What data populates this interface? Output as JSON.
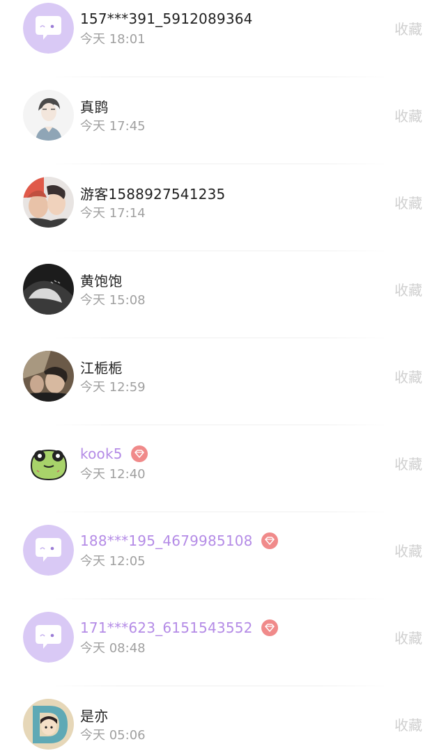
{
  "favorite_label": "收藏",
  "colors": {
    "vip_name": "#b48be6",
    "vip_badge": "#f08a8a",
    "default_avatar_bg": "#d9c9f5",
    "time_text": "#a0a0a0",
    "favorite_text": "#cfcfcf"
  },
  "visitors": [
    {
      "name": "157***391_5912089364",
      "time": "今天 18:01",
      "vip": false,
      "avatar": "default-chat-avatar"
    },
    {
      "name": "真鹍",
      "time": "今天 17:45",
      "vip": false,
      "avatar": "anime-boy-avatar"
    },
    {
      "name": "游客1588927541235",
      "time": "今天 17:14",
      "vip": false,
      "avatar": "couple-photo-avatar"
    },
    {
      "name": "黄饱饱",
      "time": "今天 15:08",
      "vip": false,
      "avatar": "dark-photo-avatar"
    },
    {
      "name": "江栀栀",
      "time": "今天 12:59",
      "vip": false,
      "avatar": "selfie-photo-avatar"
    },
    {
      "name": "kook5",
      "time": "今天 12:40",
      "vip": true,
      "avatar": "green-frog-avatar"
    },
    {
      "name": "188***195_4679985108",
      "time": "今天 12:05",
      "vip": true,
      "avatar": "default-chat-avatar"
    },
    {
      "name": "171***623_6151543552",
      "time": "今天 08:48",
      "vip": true,
      "avatar": "default-chat-avatar"
    },
    {
      "name": "是亦",
      "time": "今天 05:06",
      "vip": false,
      "avatar": "cartoon-girl-letter-d-avatar"
    }
  ]
}
